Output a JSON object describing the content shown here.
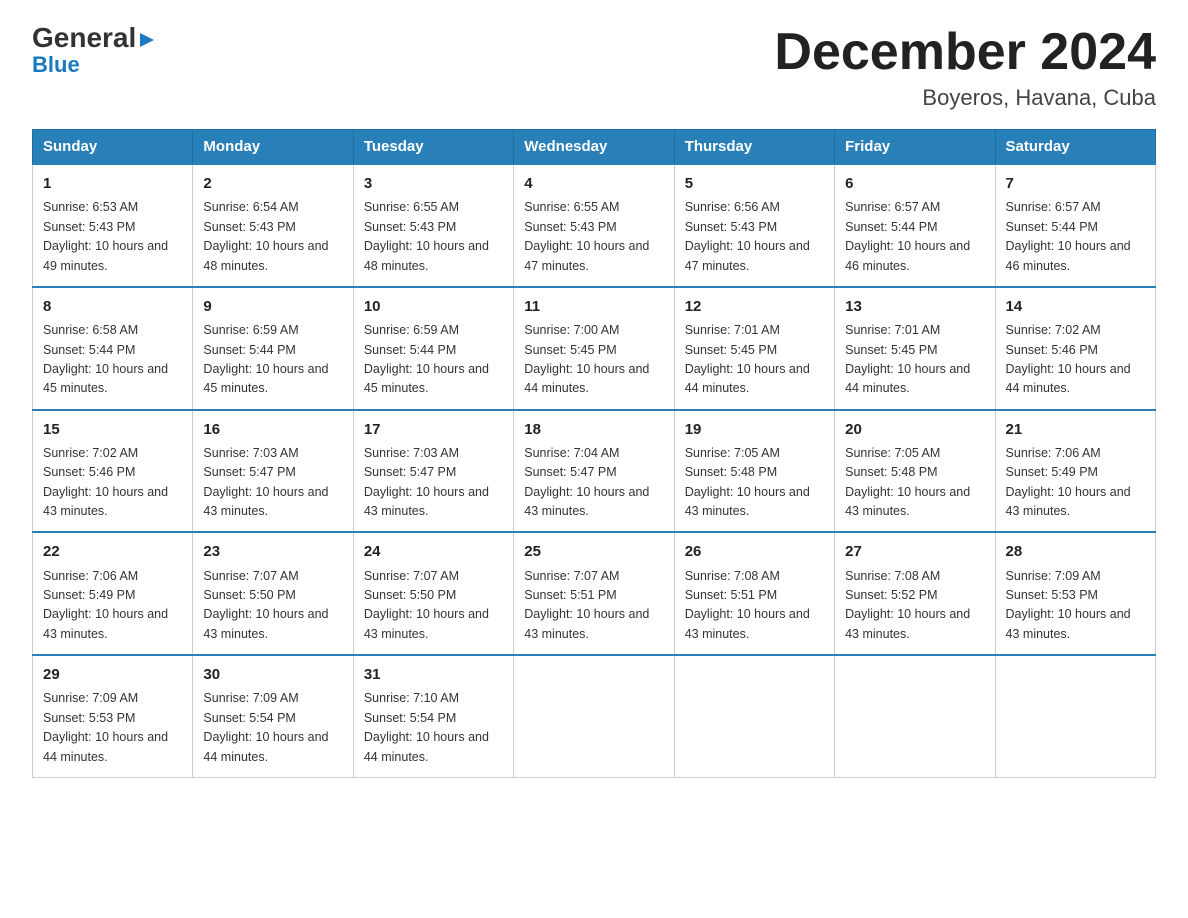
{
  "logo": {
    "general": "General",
    "arrow": "▶",
    "blue": "Blue"
  },
  "title": "December 2024",
  "location": "Boyeros, Havana, Cuba",
  "headers": [
    "Sunday",
    "Monday",
    "Tuesday",
    "Wednesday",
    "Thursday",
    "Friday",
    "Saturday"
  ],
  "weeks": [
    [
      {
        "day": "1",
        "sunrise": "Sunrise: 6:53 AM",
        "sunset": "Sunset: 5:43 PM",
        "daylight": "Daylight: 10 hours and 49 minutes."
      },
      {
        "day": "2",
        "sunrise": "Sunrise: 6:54 AM",
        "sunset": "Sunset: 5:43 PM",
        "daylight": "Daylight: 10 hours and 48 minutes."
      },
      {
        "day": "3",
        "sunrise": "Sunrise: 6:55 AM",
        "sunset": "Sunset: 5:43 PM",
        "daylight": "Daylight: 10 hours and 48 minutes."
      },
      {
        "day": "4",
        "sunrise": "Sunrise: 6:55 AM",
        "sunset": "Sunset: 5:43 PM",
        "daylight": "Daylight: 10 hours and 47 minutes."
      },
      {
        "day": "5",
        "sunrise": "Sunrise: 6:56 AM",
        "sunset": "Sunset: 5:43 PM",
        "daylight": "Daylight: 10 hours and 47 minutes."
      },
      {
        "day": "6",
        "sunrise": "Sunrise: 6:57 AM",
        "sunset": "Sunset: 5:44 PM",
        "daylight": "Daylight: 10 hours and 46 minutes."
      },
      {
        "day": "7",
        "sunrise": "Sunrise: 6:57 AM",
        "sunset": "Sunset: 5:44 PM",
        "daylight": "Daylight: 10 hours and 46 minutes."
      }
    ],
    [
      {
        "day": "8",
        "sunrise": "Sunrise: 6:58 AM",
        "sunset": "Sunset: 5:44 PM",
        "daylight": "Daylight: 10 hours and 45 minutes."
      },
      {
        "day": "9",
        "sunrise": "Sunrise: 6:59 AM",
        "sunset": "Sunset: 5:44 PM",
        "daylight": "Daylight: 10 hours and 45 minutes."
      },
      {
        "day": "10",
        "sunrise": "Sunrise: 6:59 AM",
        "sunset": "Sunset: 5:44 PM",
        "daylight": "Daylight: 10 hours and 45 minutes."
      },
      {
        "day": "11",
        "sunrise": "Sunrise: 7:00 AM",
        "sunset": "Sunset: 5:45 PM",
        "daylight": "Daylight: 10 hours and 44 minutes."
      },
      {
        "day": "12",
        "sunrise": "Sunrise: 7:01 AM",
        "sunset": "Sunset: 5:45 PM",
        "daylight": "Daylight: 10 hours and 44 minutes."
      },
      {
        "day": "13",
        "sunrise": "Sunrise: 7:01 AM",
        "sunset": "Sunset: 5:45 PM",
        "daylight": "Daylight: 10 hours and 44 minutes."
      },
      {
        "day": "14",
        "sunrise": "Sunrise: 7:02 AM",
        "sunset": "Sunset: 5:46 PM",
        "daylight": "Daylight: 10 hours and 44 minutes."
      }
    ],
    [
      {
        "day": "15",
        "sunrise": "Sunrise: 7:02 AM",
        "sunset": "Sunset: 5:46 PM",
        "daylight": "Daylight: 10 hours and 43 minutes."
      },
      {
        "day": "16",
        "sunrise": "Sunrise: 7:03 AM",
        "sunset": "Sunset: 5:47 PM",
        "daylight": "Daylight: 10 hours and 43 minutes."
      },
      {
        "day": "17",
        "sunrise": "Sunrise: 7:03 AM",
        "sunset": "Sunset: 5:47 PM",
        "daylight": "Daylight: 10 hours and 43 minutes."
      },
      {
        "day": "18",
        "sunrise": "Sunrise: 7:04 AM",
        "sunset": "Sunset: 5:47 PM",
        "daylight": "Daylight: 10 hours and 43 minutes."
      },
      {
        "day": "19",
        "sunrise": "Sunrise: 7:05 AM",
        "sunset": "Sunset: 5:48 PM",
        "daylight": "Daylight: 10 hours and 43 minutes."
      },
      {
        "day": "20",
        "sunrise": "Sunrise: 7:05 AM",
        "sunset": "Sunset: 5:48 PM",
        "daylight": "Daylight: 10 hours and 43 minutes."
      },
      {
        "day": "21",
        "sunrise": "Sunrise: 7:06 AM",
        "sunset": "Sunset: 5:49 PM",
        "daylight": "Daylight: 10 hours and 43 minutes."
      }
    ],
    [
      {
        "day": "22",
        "sunrise": "Sunrise: 7:06 AM",
        "sunset": "Sunset: 5:49 PM",
        "daylight": "Daylight: 10 hours and 43 minutes."
      },
      {
        "day": "23",
        "sunrise": "Sunrise: 7:07 AM",
        "sunset": "Sunset: 5:50 PM",
        "daylight": "Daylight: 10 hours and 43 minutes."
      },
      {
        "day": "24",
        "sunrise": "Sunrise: 7:07 AM",
        "sunset": "Sunset: 5:50 PM",
        "daylight": "Daylight: 10 hours and 43 minutes."
      },
      {
        "day": "25",
        "sunrise": "Sunrise: 7:07 AM",
        "sunset": "Sunset: 5:51 PM",
        "daylight": "Daylight: 10 hours and 43 minutes."
      },
      {
        "day": "26",
        "sunrise": "Sunrise: 7:08 AM",
        "sunset": "Sunset: 5:51 PM",
        "daylight": "Daylight: 10 hours and 43 minutes."
      },
      {
        "day": "27",
        "sunrise": "Sunrise: 7:08 AM",
        "sunset": "Sunset: 5:52 PM",
        "daylight": "Daylight: 10 hours and 43 minutes."
      },
      {
        "day": "28",
        "sunrise": "Sunrise: 7:09 AM",
        "sunset": "Sunset: 5:53 PM",
        "daylight": "Daylight: 10 hours and 43 minutes."
      }
    ],
    [
      {
        "day": "29",
        "sunrise": "Sunrise: 7:09 AM",
        "sunset": "Sunset: 5:53 PM",
        "daylight": "Daylight: 10 hours and 44 minutes."
      },
      {
        "day": "30",
        "sunrise": "Sunrise: 7:09 AM",
        "sunset": "Sunset: 5:54 PM",
        "daylight": "Daylight: 10 hours and 44 minutes."
      },
      {
        "day": "31",
        "sunrise": "Sunrise: 7:10 AM",
        "sunset": "Sunset: 5:54 PM",
        "daylight": "Daylight: 10 hours and 44 minutes."
      },
      null,
      null,
      null,
      null
    ]
  ]
}
